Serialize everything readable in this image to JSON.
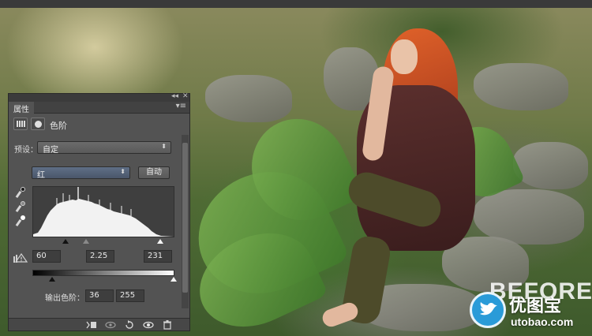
{
  "panel": {
    "tab_label": "属性",
    "collapse_glyph": "◂◂",
    "close_glyph": "✕",
    "menu_glyph": "▾≡",
    "adjustment_title": "色阶",
    "preset_label": "预设：",
    "preset_value": "自定",
    "channel_value": "红",
    "auto_label": "自动",
    "input_black": "60",
    "input_gray": "2.25",
    "input_white": "231",
    "output_label": "输出色阶：",
    "output_black": "36",
    "output_white": "255"
  },
  "icons": {
    "histogram": "histogram-icon",
    "mask": "mask-icon",
    "eyedropper_black": "eyedropper-black-icon",
    "eyedropper_gray": "eyedropper-gray-icon",
    "eyedropper_white": "eyedropper-white-icon",
    "clip_warning": "clipping-warning-icon",
    "clip_to_layer": "clip-to-layer-icon",
    "view_previous": "view-previous-icon",
    "reset": "reset-icon",
    "visibility": "eye-icon",
    "delete": "trash-icon"
  },
  "watermark": {
    "before": "BEFORE",
    "brand": "优图宝",
    "url": "utobao.com"
  },
  "colors": {
    "panel_bg": "#535353",
    "channel_select": "#5f6f86",
    "logo_blue": "#2a9bd8"
  }
}
